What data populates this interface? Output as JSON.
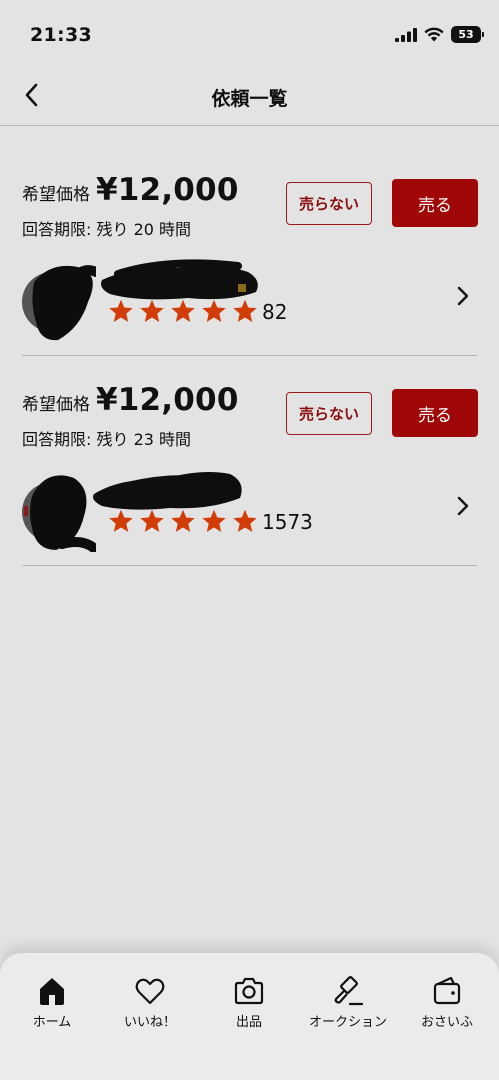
{
  "status_bar": {
    "time": "21:33",
    "battery": "53"
  },
  "header": {
    "title": "依頼一覧"
  },
  "requests": [
    {
      "price_label": "希望価格",
      "price": "¥12,000",
      "deadline": "回答期限: 残り 20 時間",
      "decline_label": "売らない",
      "sell_label": "売る",
      "rating": 5,
      "rating_count": "82"
    },
    {
      "price_label": "希望価格",
      "price": "¥12,000",
      "deadline": "回答期限: 残り 23 時間",
      "decline_label": "売らない",
      "sell_label": "売る",
      "rating": 5,
      "rating_count": "1573"
    }
  ],
  "tab_bar": {
    "items": [
      {
        "label": "ホーム",
        "icon": "home-icon"
      },
      {
        "label": "いいね！",
        "icon": "heart-icon"
      },
      {
        "label": "出品",
        "icon": "camera-icon"
      },
      {
        "label": "オークション",
        "icon": "gavel-icon"
      },
      {
        "label": "おさいふ",
        "icon": "wallet-icon"
      }
    ]
  },
  "colors": {
    "accent": "#a00808",
    "star": "#d23c07",
    "background": "#e3e3e3"
  }
}
